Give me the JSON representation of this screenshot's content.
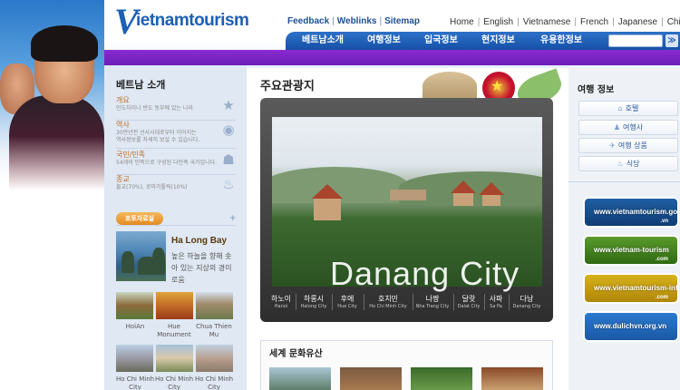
{
  "header": {
    "logo_text": "ietnamtourism",
    "logo_letter": "V",
    "util_links": [
      "Feedback",
      "Weblinks",
      "Sitemap"
    ],
    "languages": [
      "Home",
      "English",
      "Vietnamese",
      "French",
      "Japanese",
      "Chinese"
    ],
    "nav": [
      "베트남소개",
      "여행정보",
      "입국정보",
      "현지정보",
      "유용한정보"
    ],
    "search_placeholder": "",
    "search_button": "≫"
  },
  "colors": {
    "nav_blue": "#1c5fb4",
    "purple_bar": "#7a24c4",
    "accent_orange": "#e28a22"
  },
  "sidebar": {
    "title": "베트남 소개",
    "items": [
      {
        "title": "개요",
        "desc": "인도차이나 반도 동부에 있는 나라",
        "icon": "star-icon"
      },
      {
        "title": "역사",
        "desc": "30만년전 선사시대로부터 이어지는",
        "desc2": "역사정보를 자세히 보실 수 있습니다.",
        "icon": "globe-icon"
      },
      {
        "title": "국민/민족",
        "desc": "54개의 민족으로 구성된 다민족 국가입니다.",
        "icon": "people-icon"
      },
      {
        "title": "종교",
        "desc": "불교(70%), 로마가톨릭(10%)",
        "icon": "flame-icon"
      }
    ],
    "photo_tab": "포토자료실",
    "photo_plus": "+",
    "feature": {
      "title": "Ha Long Bay",
      "desc": "높은 하늘을 향해 솟아 있는 지상의 경이로움"
    },
    "thumbs": [
      {
        "caption": "HoiAn"
      },
      {
        "caption": "Hue Monument"
      },
      {
        "caption": "Chua Thien Mu"
      },
      {
        "caption": "Ho Chi Minh City"
      },
      {
        "caption": "Ho Chi Minh City"
      },
      {
        "caption": "Ho Chi Minh City"
      }
    ]
  },
  "main": {
    "title": "주요관광지",
    "slide_caption": "Danang City",
    "cities": [
      {
        "ko": "하노이",
        "en": "Hanoi"
      },
      {
        "ko": "하롱시",
        "en": "Halong City"
      },
      {
        "ko": "후에",
        "en": "Hue City"
      },
      {
        "ko": "호치민",
        "en": "Ho Chi Minh City"
      },
      {
        "ko": "나짱",
        "en": "Nha Trang City"
      },
      {
        "ko": "달랏",
        "en": "Dalat City"
      },
      {
        "ko": "사파",
        "en": "Sa Pa"
      },
      {
        "ko": "다낭",
        "en": "Danang City"
      }
    ],
    "heritage_title": "세계 문화유산"
  },
  "right": {
    "title": "여행 정보",
    "buttons": [
      {
        "label": "호텔",
        "icon": "hotel-icon"
      },
      {
        "label": "여행사",
        "icon": "agency-icon"
      },
      {
        "label": "여행 상품",
        "icon": "plane-icon"
      },
      {
        "label": "식당",
        "icon": "restaurant-icon"
      }
    ],
    "banners": [
      {
        "text": "www.vietnamtourism.gov",
        "sub": ".vn"
      },
      {
        "text": "www.vietnam-tourism",
        "sub": ".com"
      },
      {
        "text": "www.vietnamtourism-info",
        "sub": ".com"
      },
      {
        "text": "www.dulichvn.org.vn",
        "sub": ""
      }
    ]
  }
}
